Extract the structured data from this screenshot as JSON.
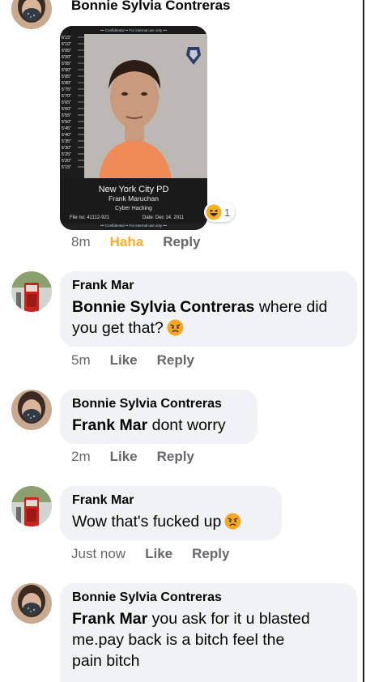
{
  "top_comment": {
    "author": "Bonnie Sylvia Contreras",
    "image": {
      "banner_top": "••• Confidential •• For internal use only •••",
      "height_marks": [
        "6'15\"",
        "6'10\"",
        "6'05\"",
        "6'00\"",
        "5'95\"",
        "5'90\"",
        "5'85\"",
        "5'80\"",
        "5'75\"",
        "5'70\"",
        "5'65\"",
        "5'60\"",
        "5'55\"",
        "5'50\"",
        "5'45\"",
        "5'40\"",
        "5'35\"",
        "5'30\"",
        "5'25\"",
        "5'20\"",
        "5'15\""
      ],
      "dept": "New York City PD",
      "name": "Frank Maruchan",
      "crime": "Cyber Hacking",
      "file_no": "File no: 41112-921",
      "date": "Date: Dec 14. 2011",
      "banner_bottom": "••• Confidential •• For internal use only •••"
    },
    "reaction": {
      "emoji": "laughing-reaction-icon",
      "count": "1"
    },
    "time": "8m",
    "reaction_label": "Haha",
    "reply": "Reply"
  },
  "replies": [
    {
      "author": "Frank Mar",
      "mention": "Bonnie Sylvia Contreras",
      "text": " where did you get that?",
      "emoji": "angry-face-icon",
      "time": "5m",
      "like": "Like",
      "reply": "Reply"
    },
    {
      "author": "Bonnie Sylvia Contreras",
      "mention": "Frank Mar",
      "text": " dont worry",
      "time": "2m",
      "like": "Like",
      "reply": "Reply"
    },
    {
      "author": "Frank Mar",
      "text": "Wow that's fucked up",
      "emoji": "angry-face-icon",
      "time": "Just now",
      "like": "Like",
      "reply": "Reply"
    },
    {
      "author": "Bonnie Sylvia Contreras",
      "mention": "Frank Mar",
      "text": " you ask for it u blasted me.pay back is a bitch feel the pain bitch"
    }
  ],
  "colors": {
    "bubble": "#f0f2f5",
    "meta": "#65676b",
    "haha": "#f7b125"
  }
}
